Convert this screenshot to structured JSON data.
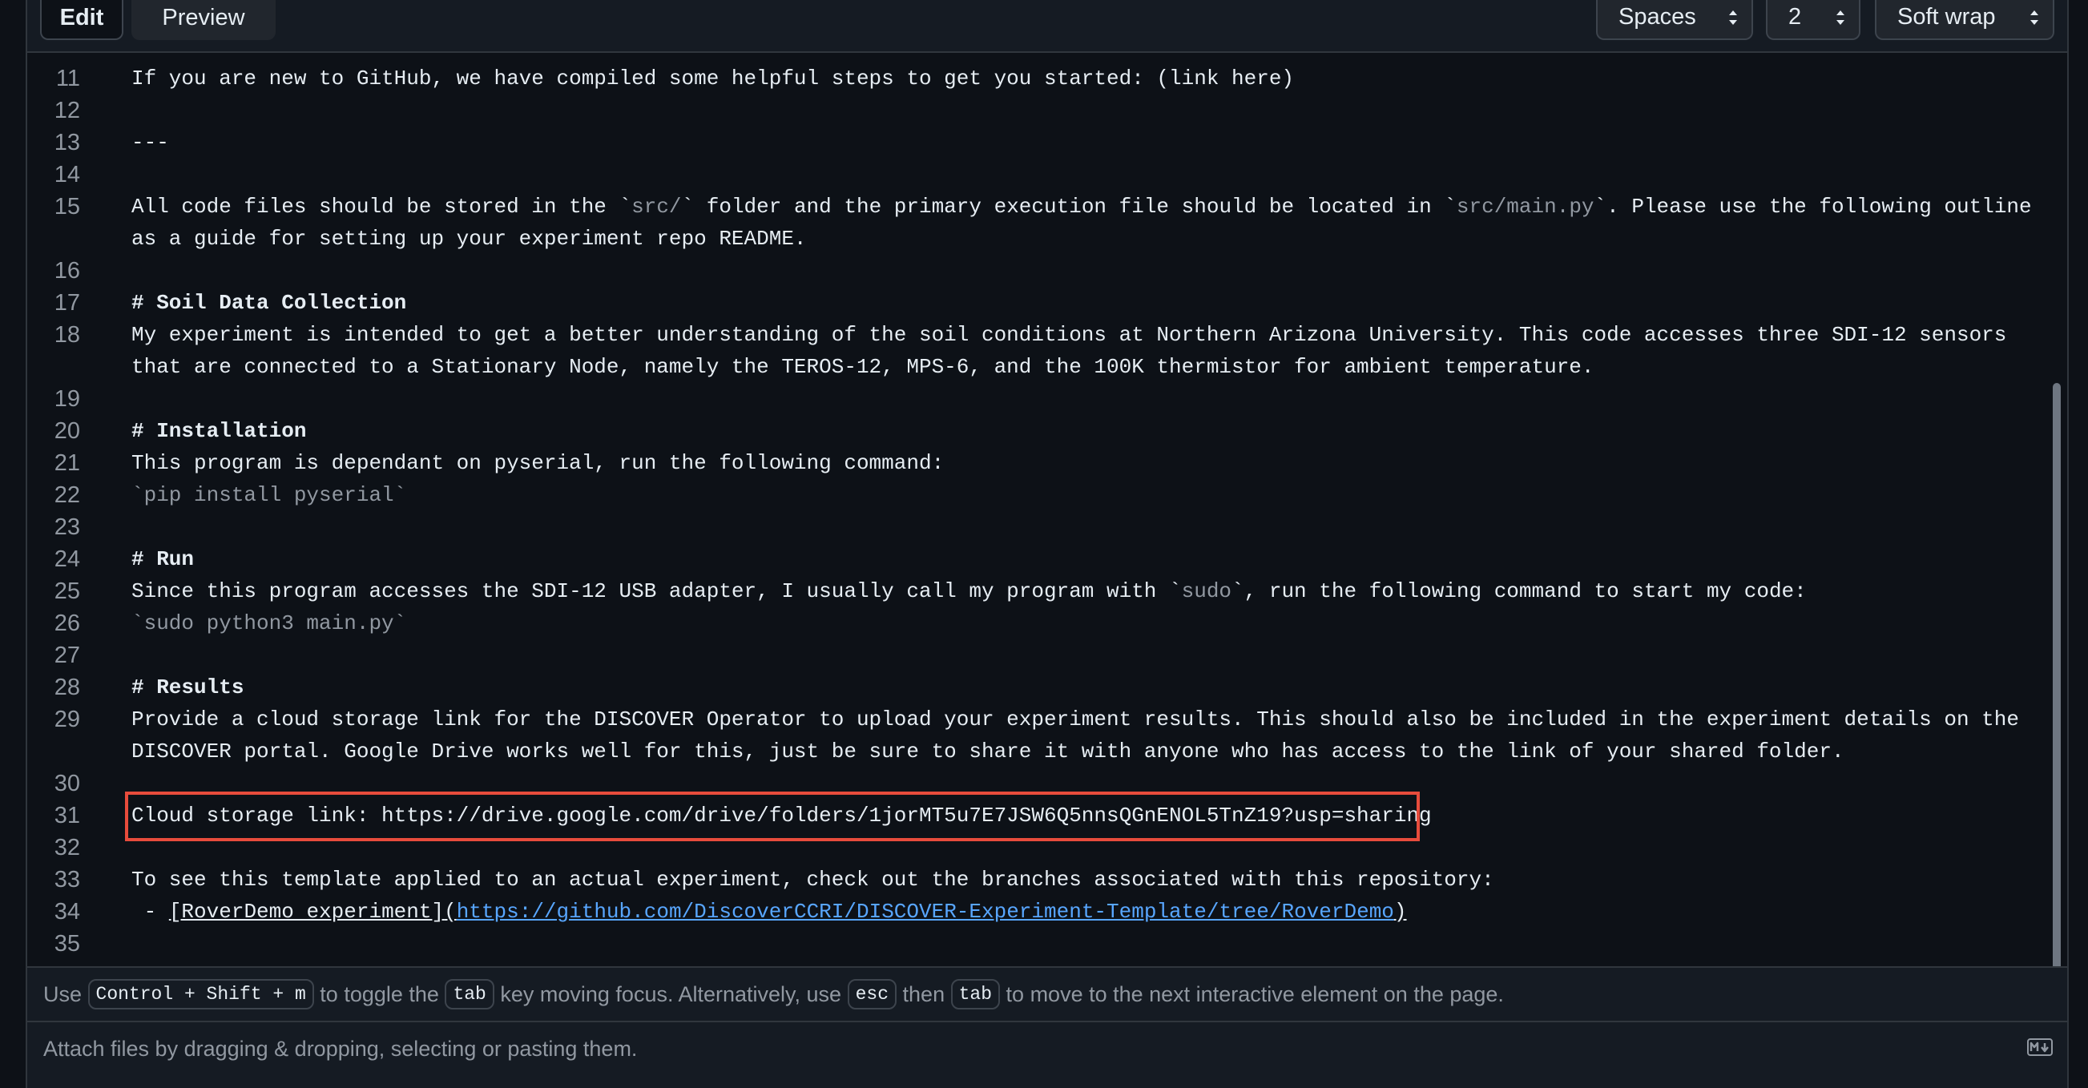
{
  "toolbar": {
    "tab_edit": "Edit",
    "tab_preview": "Preview",
    "indent_mode": "Spaces",
    "indent_size": "2",
    "wrap_mode": "Soft wrap"
  },
  "editor": {
    "lines": [
      {
        "n": "11",
        "text": "If you are new to GitHub, we have compiled some helpful steps to get you started: (link here)"
      },
      {
        "n": "12",
        "text": ""
      },
      {
        "n": "13",
        "text": "---"
      },
      {
        "n": "14",
        "text": ""
      },
      {
        "n": "15",
        "pre": "All code files should be stored in the `",
        "m1": "src/",
        "mid": "` folder and the primary execution file should be located in `",
        "m2": "src/main.py",
        "post": "`. Please use the following outline as a guide for setting up your experiment repo README."
      },
      {
        "n": "16",
        "text": ""
      },
      {
        "n": "17",
        "text": "# Soil Data Collection"
      },
      {
        "n": "18",
        "text": "My experiment is intended to get a better understanding of the soil conditions at Northern Arizona University. This code accesses three SDI-12 sensors that are connected to a Stationary Node, namely the TEROS-12, MPS-6, and the 100K thermistor for ambient temperature."
      },
      {
        "n": "19",
        "text": ""
      },
      {
        "n": "20",
        "text": "# Installation"
      },
      {
        "n": "21",
        "text": "This program is dependant on pyserial, run the following command:"
      },
      {
        "n": "22",
        "text": "`pip install pyserial`"
      },
      {
        "n": "23",
        "text": ""
      },
      {
        "n": "24",
        "text": "# Run"
      },
      {
        "n": "25",
        "pre": "Since this program accesses the SDI-12 USB adapter, I usually call my program with `",
        "m1": "sudo",
        "post": "`, run the following command to start my code:"
      },
      {
        "n": "26",
        "text": "`sudo python3 main.py`"
      },
      {
        "n": "27",
        "text": ""
      },
      {
        "n": "28",
        "text": "# Results"
      },
      {
        "n": "29",
        "text": "Provide a cloud storage link for the DISCOVER Operator to upload your experiment results. This should also be included in the experiment details on the DISCOVER portal. Google Drive works well for this, just be sure to share it with anyone who has access to the link of your shared folder."
      },
      {
        "n": "30",
        "text": ""
      },
      {
        "n": "31",
        "text": "Cloud storage link: https://drive.google.com/drive/folders/1jorMT5u7E7JSW6Q5nnsQGnENOL5TnZ19?usp=sharing"
      },
      {
        "n": "32",
        "text": ""
      },
      {
        "n": "33",
        "text": "To see this template applied to an actual experiment, check out the branches associated with this repository:"
      },
      {
        "n": "34",
        "prefix": " - ",
        "link_text": "[RoverDemo experiment]",
        "paren_open": "(",
        "url": "https://github.com/DiscoverCCRI/DISCOVER-Experiment-Template/tree/RoverDemo",
        "paren_close": ")"
      },
      {
        "n": "35",
        "text": ""
      }
    ]
  },
  "hint": {
    "use": "Use",
    "shortcut": "Control + Shift + m",
    "toggle": "to toggle the",
    "tab_key": "tab",
    "focus": "key moving focus. Alternatively, use",
    "esc_key": "esc",
    "then": "then",
    "tab_key2": "tab",
    "rest": "to move to the next interactive element on the page."
  },
  "attach": {
    "text": "Attach files by dragging & dropping, selecting or pasting them."
  },
  "colors": {
    "background": "#0d1117",
    "highlight_border": "#e74c3c",
    "link": "#58a6ff"
  }
}
